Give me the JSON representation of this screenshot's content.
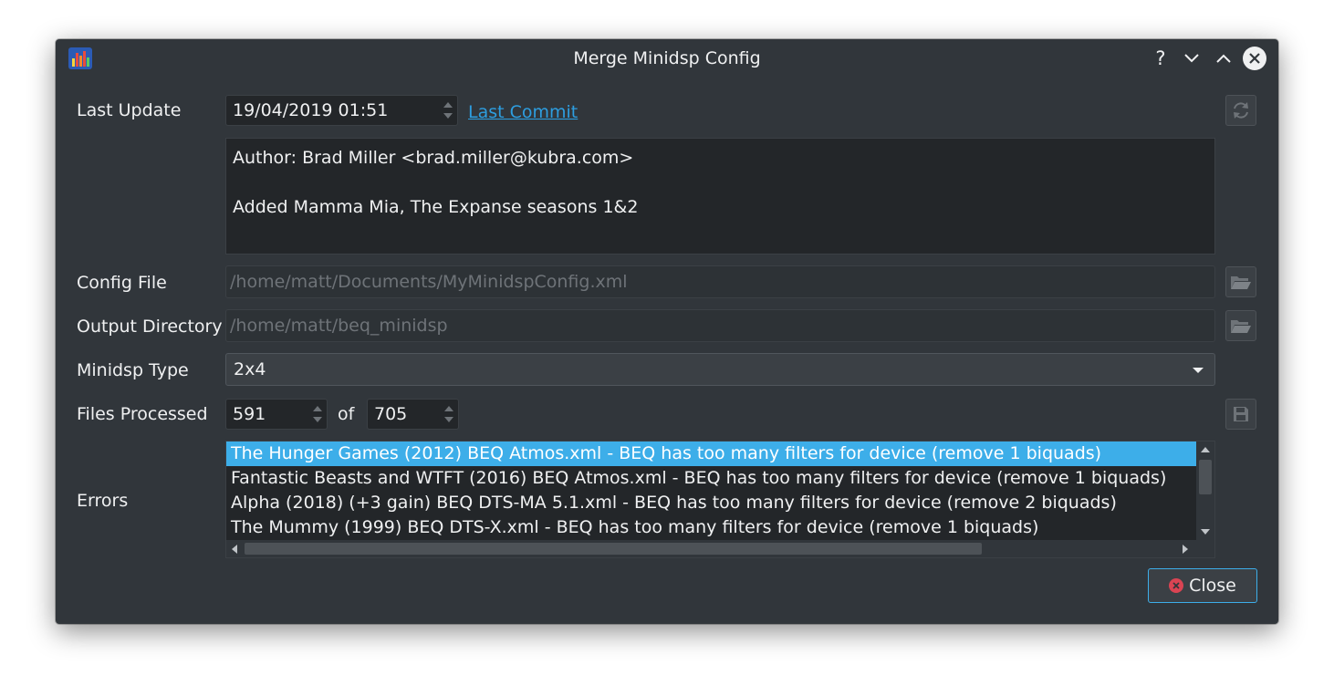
{
  "window": {
    "title": "Merge Minidsp Config",
    "help_glyph": "?"
  },
  "last_update": {
    "label": "Last Update",
    "value": "19/04/2019 01:51",
    "link": "Last Commit"
  },
  "commit_message": {
    "lines": [
      "Author: Brad Miller <brad.miller@kubra.com>",
      "",
      "Added Mamma Mia, The Expanse seasons 1&2"
    ]
  },
  "config_file": {
    "label": "Config File",
    "value": "/home/matt/Documents/MyMinidspConfig.xml"
  },
  "output_directory": {
    "label": "Output Directory",
    "value": "/home/matt/beq_minidsp"
  },
  "minidsp_type": {
    "label": "Minidsp Type",
    "selected": "2x4"
  },
  "files_processed": {
    "label": "Files Processed",
    "processed": "591",
    "of_label": "of",
    "total": "705"
  },
  "errors": {
    "label": "Errors",
    "items": [
      "The Hunger Games (2012) BEQ Atmos.xml - BEQ has too many filters for device (remove 1 biquads)",
      "Fantastic Beasts and WTFT (2016) BEQ Atmos.xml - BEQ has too many filters for device (remove 1 biquads)",
      "Alpha (2018) (+3 gain) BEQ DTS-MA 5.1.xml - BEQ has too many filters for device (remove 2 biquads)",
      "The Mummy (1999) BEQ DTS-X.xml - BEQ has too many filters for device (remove 1 biquads)"
    ],
    "selected_index": 0
  },
  "buttons": {
    "close_label": "Close"
  },
  "colors": {
    "accent": "#3daee9",
    "window_bg": "#31363b",
    "field_bg": "#232629",
    "link": "#2d9ee0",
    "close_icon": "#da4453"
  }
}
